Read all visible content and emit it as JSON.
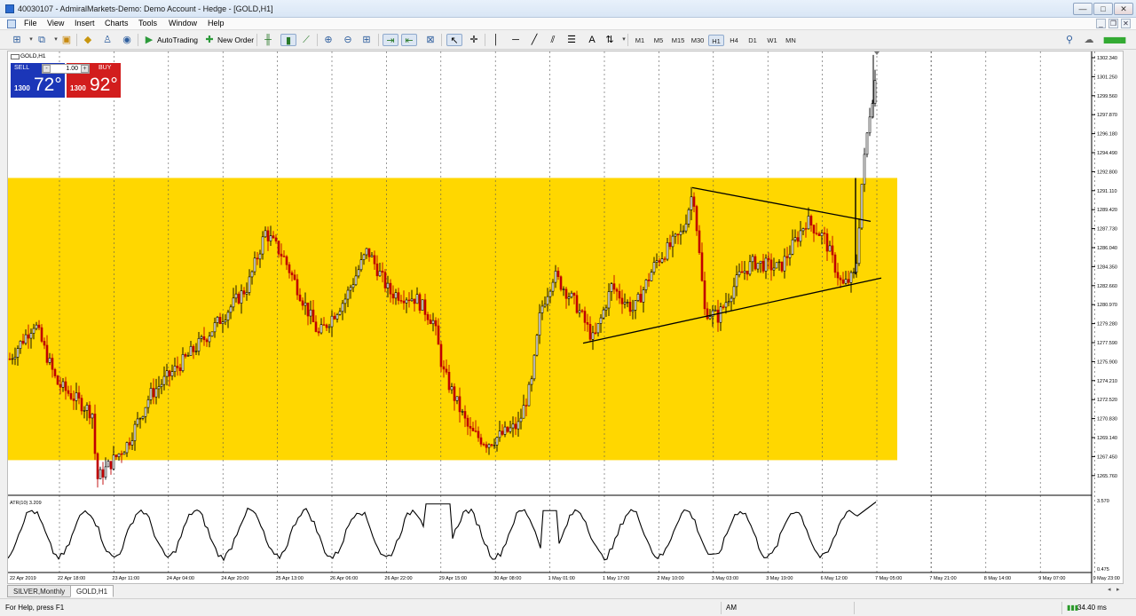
{
  "window": {
    "title": "40030107 - AdmiralMarkets-Demo: Demo Account - Hedge - [GOLD,H1]",
    "controls": [
      "—",
      "□",
      "✕"
    ],
    "mdi_controls": [
      "_",
      "❐",
      "✕"
    ]
  },
  "menu": [
    "File",
    "View",
    "Insert",
    "Charts",
    "Tools",
    "Window",
    "Help"
  ],
  "toolbar": {
    "autotrading_label": "AutoTrading",
    "new_order_label": "New Order",
    "timeframes": [
      "M1",
      "M5",
      "M15",
      "M30",
      "H1",
      "H4",
      "D1",
      "W1",
      "MN"
    ],
    "selected_timeframe": "H1"
  },
  "trade_panel": {
    "sell_label": "SELL",
    "buy_label": "BUY",
    "lots": "1.00",
    "sell_price_small": "1300",
    "sell_price_large": "72°",
    "buy_price_small": "1300",
    "buy_price_large": "92°"
  },
  "chart": {
    "symbol_label": "GOLD,H1",
    "indicator_label": "ATR(10) 3.209",
    "zone_color": "#FFD700",
    "up_color": "#000000",
    "down_color": "#c00000",
    "price_axis": [
      "1302.340",
      "1301.250",
      "1299.560",
      "1297.870",
      "1296.180",
      "1294.490",
      "1292.800",
      "1291.110",
      "1289.420",
      "1287.730",
      "1286.040",
      "1284.350",
      "1282.660",
      "1280.970",
      "1279.280",
      "1277.590",
      "1275.900",
      "1274.210",
      "1272.520",
      "1270.830",
      "1269.140",
      "1267.450",
      "1265.760"
    ],
    "atr_axis": [
      "3.570",
      "0.475"
    ],
    "time_axis": [
      "22 Apr 2019",
      "22 Apr 18:00",
      "23 Apr 11:00",
      "24 Apr 04:00",
      "24 Apr 20:00",
      "25 Apr 13:00",
      "26 Apr 06:00",
      "26 Apr 22:00",
      "29 Apr 15:00",
      "30 Apr 08:00",
      "1 May 01:00",
      "1 May 17:00",
      "2 May 10:00",
      "3 May 03:00",
      "3 May 19:00",
      "6 May 12:00",
      "7 May 05:00",
      "7 May 21:00",
      "8 May 14:00",
      "9 May 07:00",
      "9 May 23:00",
      "10 May 16:00",
      "13 May 09:00"
    ]
  },
  "chart_data": {
    "type": "candlestick",
    "title": "GOLD,H1",
    "price_range": [
      1265.76,
      1302.34
    ],
    "support_resistance_zone": [
      1268.6,
      1292.0
    ],
    "key_levels": {
      "range_low": 1266.5,
      "range_high": 1291.2,
      "breakout_high": 1301.6
    },
    "triangle_upper_line": [
      [
        1291.2,
        "8 May 14:00"
      ],
      [
        1288.4,
        "13 May 09:00"
      ]
    ],
    "triangle_lower_line": [
      [
        1278.3,
        "6 May 12:00"
      ],
      [
        1283.7,
        "13 May 09:00"
      ]
    ]
  },
  "tabs": [
    "SILVER,Monthly",
    "GOLD,H1"
  ],
  "active_tab": "GOLD,H1",
  "status": {
    "help_text": "For Help, press F1",
    "mode": "AM",
    "ping": "34.40 ms"
  }
}
